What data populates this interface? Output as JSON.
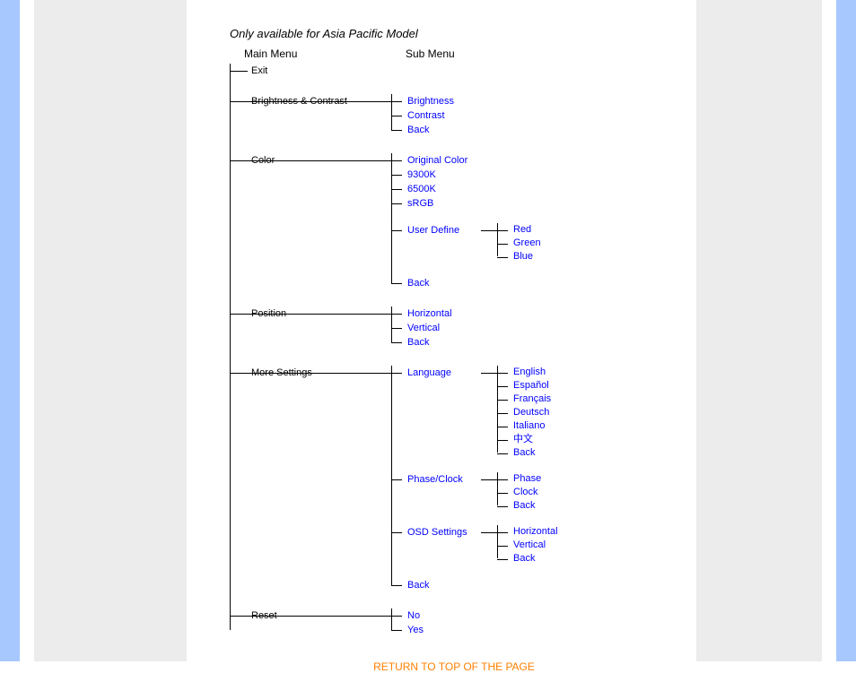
{
  "caption": "Only available for Asia Pacific Model",
  "headers": {
    "main": "Main Menu",
    "sub": "Sub Menu"
  },
  "menu": [
    {
      "label": "Exit"
    },
    {
      "label": "Brightness & Contrast",
      "sub": [
        {
          "label": "Brightness"
        },
        {
          "label": "Contrast"
        },
        {
          "label": "Back"
        }
      ]
    },
    {
      "label": "Color",
      "sub": [
        {
          "label": "Original Color"
        },
        {
          "label": "9300K"
        },
        {
          "label": "6500K"
        },
        {
          "label": "sRGB"
        },
        {
          "label": "User Define",
          "leaf": [
            "Red",
            "Green",
            "Blue"
          ]
        },
        {
          "label": "Back"
        }
      ]
    },
    {
      "label": "Position",
      "sub": [
        {
          "label": "Horizontal"
        },
        {
          "label": "Vertical"
        },
        {
          "label": "Back"
        }
      ]
    },
    {
      "label": "More Settings",
      "sub": [
        {
          "label": "Language",
          "leaf": [
            "English",
            "Español",
            "Français",
            "Deutsch",
            "Italiano",
            "中文",
            "Back"
          ]
        },
        {
          "label": "Phase/Clock",
          "leaf": [
            "Phase",
            "Clock",
            "Back"
          ]
        },
        {
          "label": "OSD Settings",
          "leaf": [
            "Horizontal",
            "Vertical",
            "Back"
          ]
        },
        {
          "label": "Back"
        }
      ]
    },
    {
      "label": "Reset",
      "sub": [
        {
          "label": "No"
        },
        {
          "label": "Yes"
        }
      ]
    }
  ],
  "return_link": "RETURN TO TOP OF THE PAGE"
}
